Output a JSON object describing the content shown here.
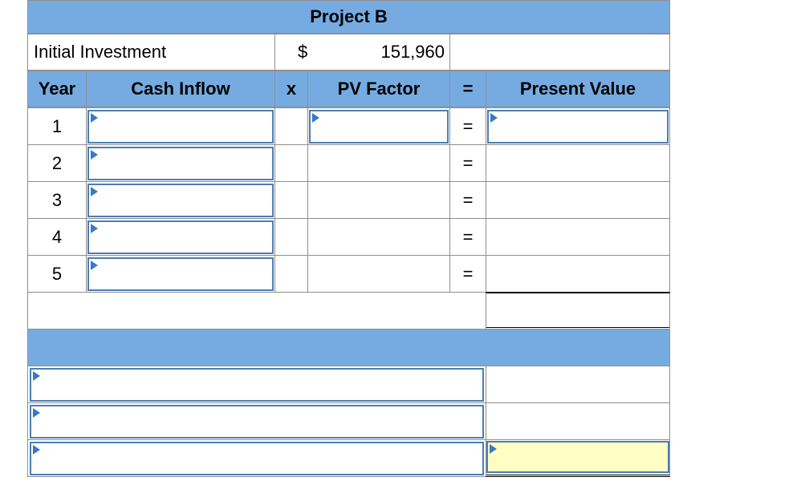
{
  "title": "Project B",
  "investment": {
    "label": "Initial Investment",
    "currency": "$",
    "amount": "151,960"
  },
  "headers": {
    "year": "Year",
    "cash_inflow": "Cash Inflow",
    "x": "x",
    "pv_factor": "PV Factor",
    "eq": "=",
    "present_value": "Present Value"
  },
  "rows": [
    {
      "year": "1",
      "eq": "="
    },
    {
      "year": "2",
      "eq": "="
    },
    {
      "year": "3",
      "eq": "="
    },
    {
      "year": "4",
      "eq": "="
    },
    {
      "year": "5",
      "eq": "="
    }
  ],
  "colors": {
    "header_blue": "#76abe1",
    "input_border": "#4a7fb5",
    "highlight": "#ffffc3"
  }
}
